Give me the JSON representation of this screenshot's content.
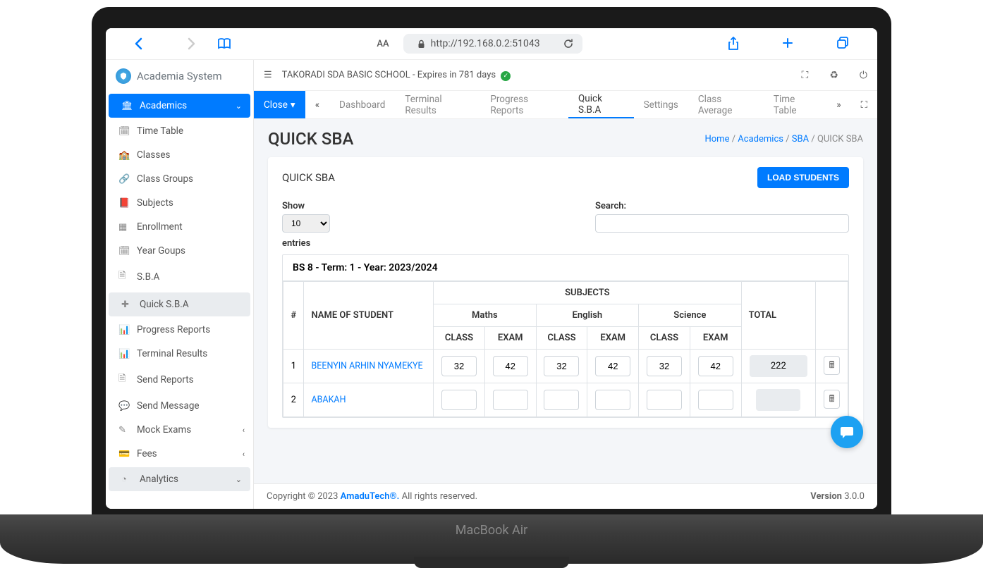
{
  "safari": {
    "url": "http://192.168.0.2:51043",
    "reader_label": "AA"
  },
  "brand": "Academia System",
  "sidebar": {
    "academics": "Academics",
    "items": [
      "Time Table",
      "Classes",
      "Class Groups",
      "Subjects",
      "Enrollment",
      "Year Goups",
      "S.B.A",
      "Quick S.B.A",
      "Progress Reports",
      "Terminal Results",
      "Send Reports",
      "Send Message",
      "Mock Exams",
      "Fees"
    ],
    "analytics": "Analytics"
  },
  "topbar": {
    "school": "TAKORADI SDA BASIC SCHOOL - Expires in 781 days"
  },
  "tabs": {
    "close": "Close",
    "items": [
      "Dashboard",
      "Terminal Results",
      "Progress Reports",
      "Quick S.B.A",
      "Settings",
      "Class Average",
      "Time Table"
    ]
  },
  "page": {
    "title": "QUICK SBA",
    "breadcrumb": {
      "home": "Home",
      "academics": "Academics",
      "sba": "SBA",
      "current": "QUICK SBA"
    }
  },
  "card": {
    "title": "QUICK SBA",
    "load_btn": "LOAD STUDENTS",
    "show_label": "Show",
    "show_value": "10",
    "entries_label": "entries",
    "search_label": "Search:",
    "table_caption": "BS 8 - Term: 1 - Year: 2023/2024",
    "cols": {
      "num": "#",
      "name": "NAME OF STUDENT",
      "subjects": "SUBJECTS",
      "total": "TOTAL"
    },
    "subjects": [
      "Maths",
      "English",
      "Science"
    ],
    "subcols": {
      "class": "CLASS",
      "exam": "EXAM"
    },
    "rows": [
      {
        "num": "1",
        "name": "BEENYIN ARHIN NYAMEKYE",
        "scores": {
          "maths_class": "32",
          "maths_exam": "42",
          "english_class": "32",
          "english_exam": "42",
          "science_class": "32",
          "science_exam": "42"
        },
        "total": "222"
      },
      {
        "num": "2",
        "name": "ABAKAH",
        "scores": {
          "maths_class": "",
          "maths_exam": "",
          "english_class": "",
          "english_exam": "",
          "science_class": "",
          "science_exam": ""
        },
        "total": ""
      }
    ]
  },
  "footer": {
    "copyright": "Copyright © 2023 ",
    "company": "AmaduTech®.",
    "rights": " All rights reserved.",
    "version_label": "Version ",
    "version": "3.0.0"
  },
  "laptop": "MacBook Air"
}
